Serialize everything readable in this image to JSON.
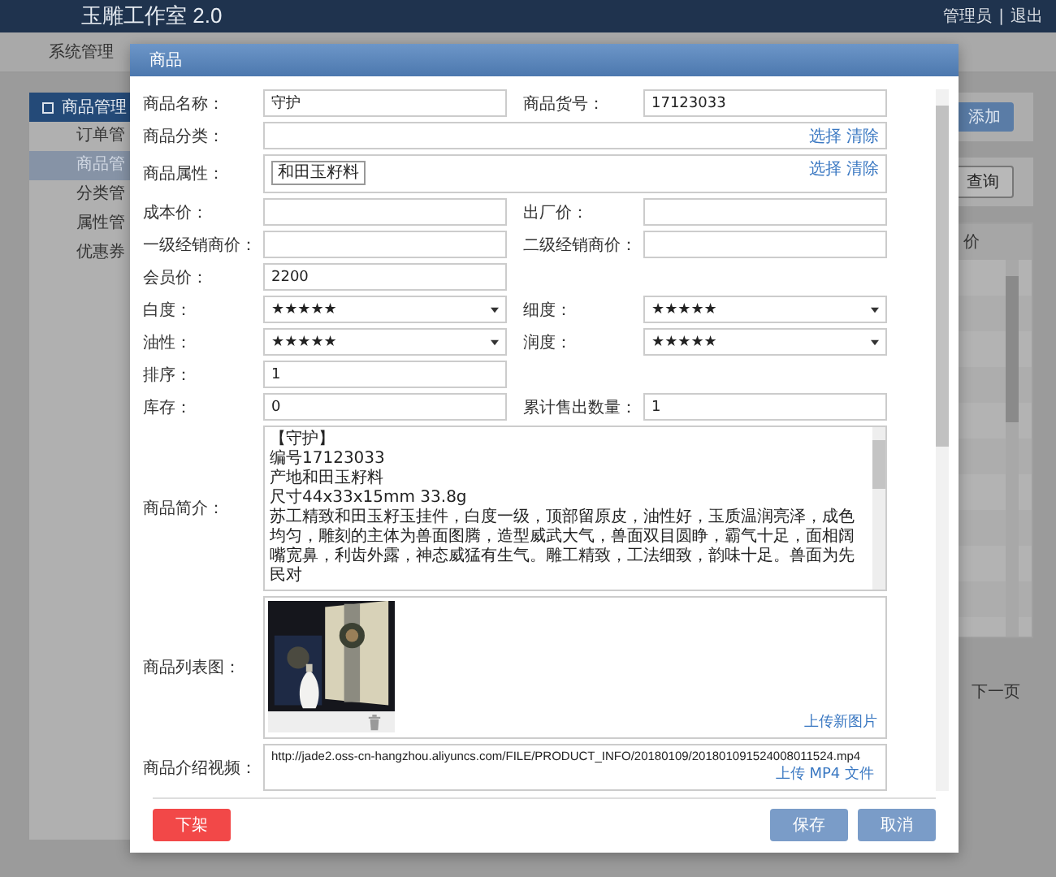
{
  "app": {
    "title": "玉雕工作室 2.0",
    "user": "管理员",
    "separator": "|",
    "logout": "退出"
  },
  "nav": [
    "系统管理"
  ],
  "sidebar": {
    "items": [
      {
        "label": "商品管理",
        "kind": "group"
      },
      {
        "label": "订单管",
        "kind": "item",
        "selected": false
      },
      {
        "label": "商品管",
        "kind": "item",
        "selected": true
      },
      {
        "label": "分类管",
        "kind": "item",
        "selected": false
      },
      {
        "label": "属性管",
        "kind": "item",
        "selected": false
      },
      {
        "label": "优惠券",
        "kind": "item",
        "selected": false
      }
    ]
  },
  "toolbar": {
    "add": "添加",
    "query": "查询"
  },
  "table": {
    "column_header": "价"
  },
  "pager": {
    "next": "下一页"
  },
  "dialog": {
    "title": "商品",
    "rows": [
      {
        "fields": [
          {
            "kind": "text",
            "label": "商品名称：",
            "value": "守护"
          },
          {
            "kind": "text",
            "label": "商品货号：",
            "value": "17123033"
          }
        ]
      },
      {
        "fields": [
          {
            "kind": "picker",
            "label": "商品分类：",
            "actions": [
              "选择",
              "清除"
            ]
          }
        ]
      },
      {
        "fields": [
          {
            "kind": "picker",
            "label": "商品属性：",
            "tags": [
              "和田玉籽料"
            ],
            "actions": [
              "选择",
              "清除"
            ]
          }
        ]
      },
      {
        "fields": [
          {
            "kind": "text",
            "label": "成本价："
          },
          {
            "kind": "text",
            "label": "出厂价："
          }
        ]
      },
      {
        "fields": [
          {
            "kind": "text",
            "label": "一级经销商价："
          },
          {
            "kind": "text",
            "label": "二级经销商价："
          }
        ]
      },
      {
        "fields": [
          {
            "kind": "text",
            "label": "会员价：",
            "value": "2200"
          }
        ]
      },
      {
        "fields": [
          {
            "kind": "select",
            "label": "白度：",
            "value": "★★★★★"
          },
          {
            "kind": "select",
            "label": "细度：",
            "value": "★★★★★"
          }
        ]
      },
      {
        "fields": [
          {
            "kind": "select",
            "label": "油性：",
            "value": "★★★★★"
          },
          {
            "kind": "select",
            "label": "润度：",
            "value": "★★★★★"
          }
        ]
      },
      {
        "fields": [
          {
            "kind": "text",
            "label": "排序：",
            "value": "1"
          }
        ]
      },
      {
        "fields": [
          {
            "kind": "text",
            "label": "库存：",
            "value": "0"
          },
          {
            "kind": "text",
            "label": "累计售出数量：",
            "value": "1"
          }
        ]
      },
      {
        "fields": [
          {
            "kind": "textarea",
            "label": "商品简介：",
            "lines": [
              "【守护】",
              "编号17123033",
              "产地和田玉籽料",
              "尺寸44x33x15mm 33.8g",
              "苏工精致和田玉籽玉挂件，白度一级，顶部留原皮，油性好，玉质温润亮泽，成色均匀，雕刻的主体为兽面图腾，造型威武大气，兽面双目圆睁，霸气十足，面相阔嘴宽鼻，利齿外露，神态威猛有生气。雕工精致，工法细致，韵味十足。兽面为先民对"
            ]
          }
        ]
      },
      {
        "fields": [
          {
            "kind": "images",
            "label": "商品列表图：",
            "action": "上传新图片"
          }
        ]
      },
      {
        "fields": [
          {
            "kind": "video",
            "label": "商品介绍视频：",
            "value": "http://jade2.oss-cn-hangzhou.aliyuncs.com/FILE/PRODUCT_INFO/20180109/201801091524008011524.mp4",
            "action": "上传 MP4 文件"
          }
        ]
      }
    ],
    "buttons": [
      {
        "label": "下架",
        "kind": "danger"
      },
      {
        "label": "保存",
        "kind": "primary"
      },
      {
        "label": "取消",
        "kind": "primary"
      }
    ]
  }
}
